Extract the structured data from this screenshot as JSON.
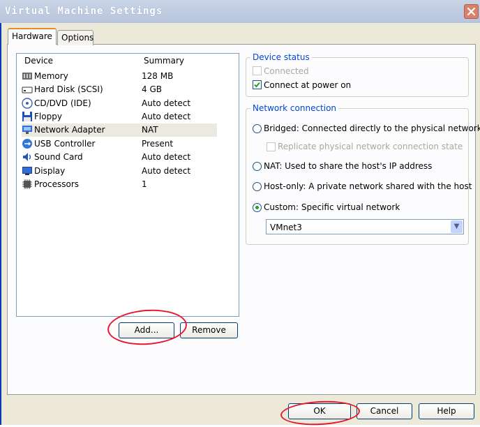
{
  "window": {
    "title": "Virtual Machine Settings"
  },
  "tabs": [
    {
      "label": "Hardware",
      "active": true
    },
    {
      "label": "Options",
      "active": false
    }
  ],
  "device_list": {
    "columns": {
      "device": "Device",
      "summary": "Summary"
    },
    "rows": [
      {
        "icon": "memory-icon",
        "name": "Memory",
        "summary": "128 MB",
        "selected": false
      },
      {
        "icon": "hard-disk-icon",
        "name": "Hard Disk (SCSI)",
        "summary": "4 GB",
        "selected": false
      },
      {
        "icon": "cd-dvd-icon",
        "name": "CD/DVD (IDE)",
        "summary": "Auto detect",
        "selected": false
      },
      {
        "icon": "floppy-icon",
        "name": "Floppy",
        "summary": "Auto detect",
        "selected": false
      },
      {
        "icon": "network-adapter-icon",
        "name": "Network Adapter",
        "summary": "NAT",
        "selected": true
      },
      {
        "icon": "usb-icon",
        "name": "USB Controller",
        "summary": "Present",
        "selected": false
      },
      {
        "icon": "sound-card-icon",
        "name": "Sound Card",
        "summary": "Auto detect",
        "selected": false
      },
      {
        "icon": "display-icon",
        "name": "Display",
        "summary": "Auto detect",
        "selected": false
      },
      {
        "icon": "processor-icon",
        "name": "Processors",
        "summary": "1",
        "selected": false
      }
    ],
    "add_label": "Add...",
    "remove_label": "Remove"
  },
  "device_status": {
    "label": "Device status",
    "connected": {
      "label": "Connected",
      "checked": false,
      "enabled": false
    },
    "connect_at_power_on": {
      "label": "Connect at power on",
      "checked": true,
      "enabled": true
    }
  },
  "network_connection": {
    "label": "Network connection",
    "bridged": "Bridged: Connected directly to the physical network",
    "replicate": "Replicate physical network connection state",
    "nat": "NAT: Used to share the host's IP address",
    "host_only": "Host-only: A private network shared with the host",
    "custom": "Custom: Specific virtual network",
    "selected": "custom",
    "vmnet_value": "VMnet3"
  },
  "footer": {
    "ok_label": "OK",
    "cancel_label": "Cancel",
    "help_label": "Help"
  },
  "colors": {
    "title_bar": "#b7c4dc",
    "groupbox_label": "#0046d5",
    "annotation": "#e6182c",
    "check": "#21a121"
  }
}
